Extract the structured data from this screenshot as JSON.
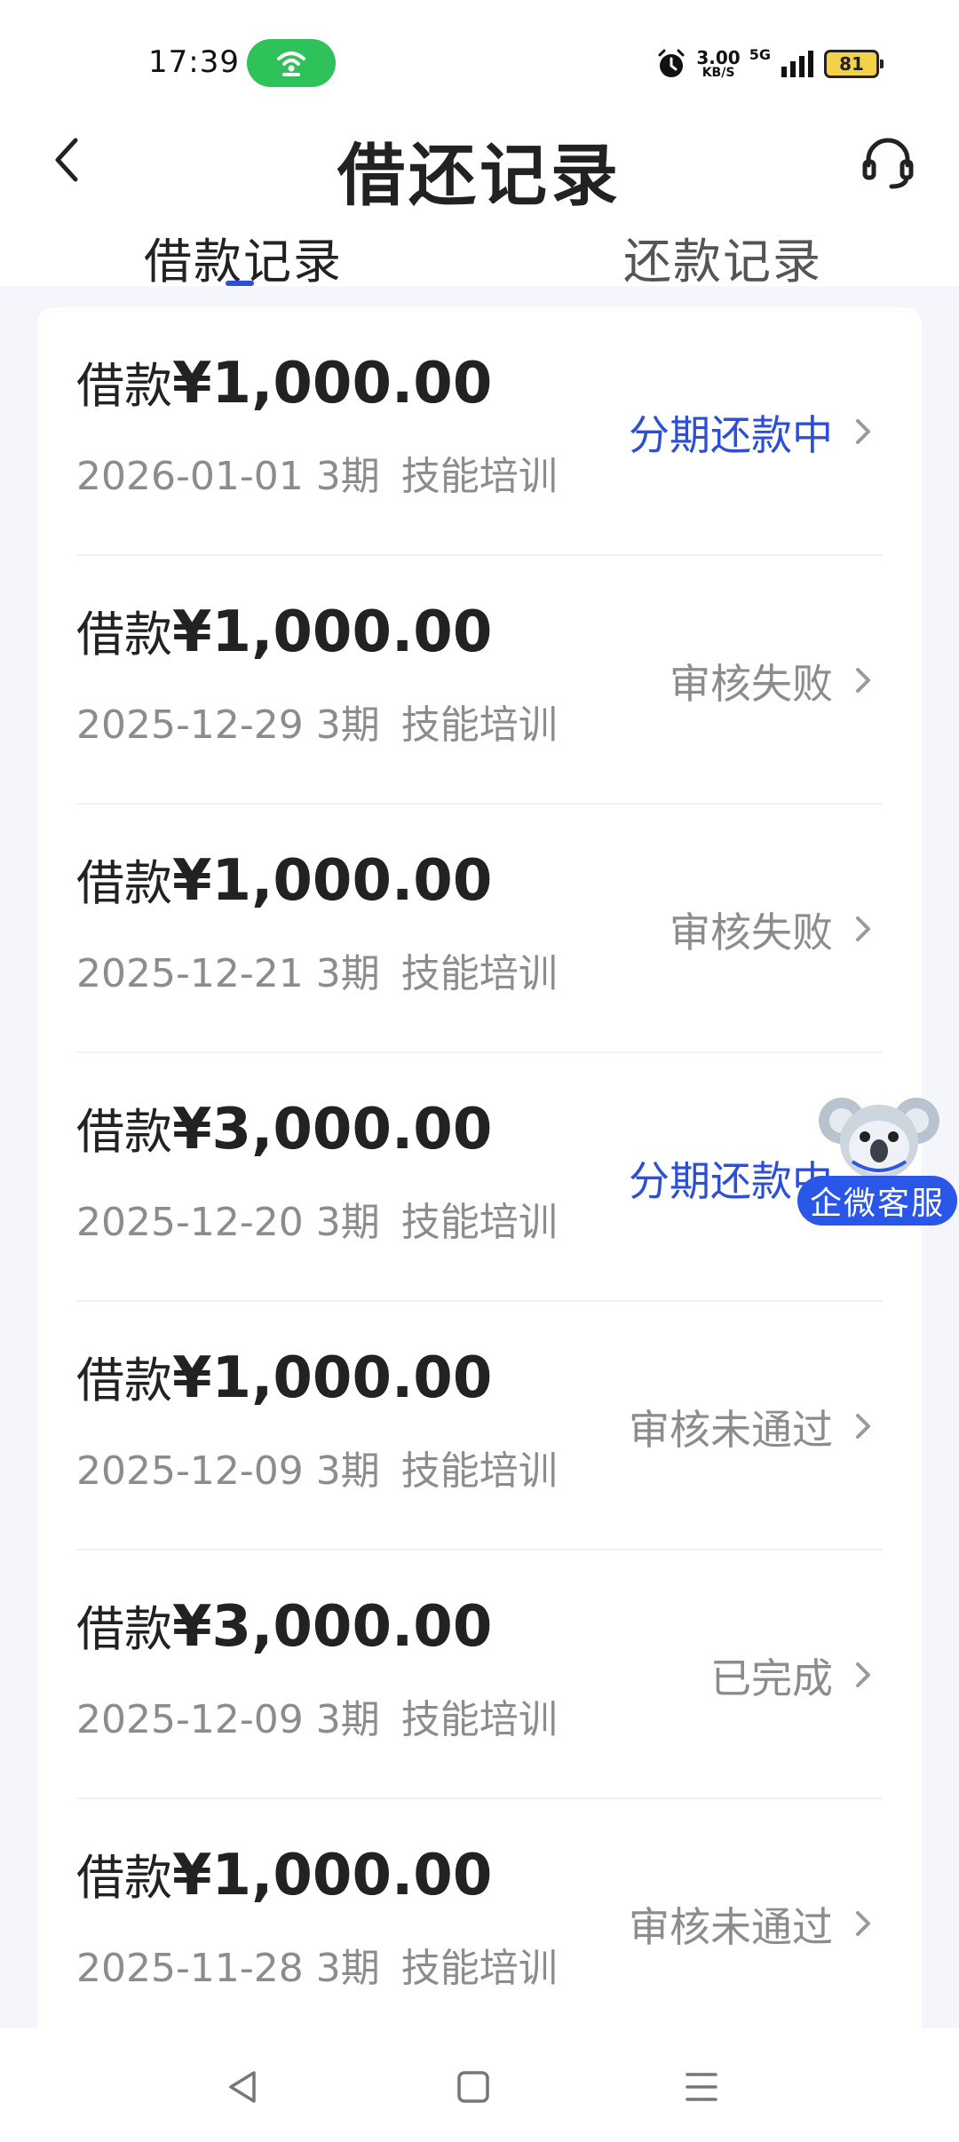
{
  "status_bar": {
    "time": "17:39",
    "network_speed_value": "3.00",
    "network_speed_unit": "KB/S",
    "network_type": "5G",
    "battery_level": "81",
    "hotspot_color": "#2fc25b"
  },
  "header": {
    "title": "借还记录",
    "back_icon": "chevron-left-icon",
    "service_icon": "headset-icon"
  },
  "tabs": [
    {
      "label": "借款记录",
      "active": true
    },
    {
      "label": "还款记录",
      "active": false
    }
  ],
  "records": [
    {
      "prefix": "借款",
      "amount": "¥1,000.00",
      "date": "2026-01-01",
      "term": "3期",
      "purpose": "技能培训",
      "status": "分期还款中",
      "status_color": "#2b4fd8"
    },
    {
      "prefix": "借款",
      "amount": "¥1,000.00",
      "date": "2025-12-29",
      "term": "3期",
      "purpose": "技能培训",
      "status": "审核失败",
      "status_color": "#8c8c8c"
    },
    {
      "prefix": "借款",
      "amount": "¥1,000.00",
      "date": "2025-12-21",
      "term": "3期",
      "purpose": "技能培训",
      "status": "审核失败",
      "status_color": "#8c8c8c"
    },
    {
      "prefix": "借款",
      "amount": "¥3,000.00",
      "date": "2025-12-20",
      "term": "3期",
      "purpose": "技能培训",
      "status": "分期还款中",
      "status_color": "#2b4fd8"
    },
    {
      "prefix": "借款",
      "amount": "¥1,000.00",
      "date": "2025-12-09",
      "term": "3期",
      "purpose": "技能培训",
      "status": "审核未通过",
      "status_color": "#8c8c8c"
    },
    {
      "prefix": "借款",
      "amount": "¥3,000.00",
      "date": "2025-12-09",
      "term": "3期",
      "purpose": "技能培训",
      "status": "已完成",
      "status_color": "#8c8c8c"
    },
    {
      "prefix": "借款",
      "amount": "¥1,000.00",
      "date": "2025-11-28",
      "term": "3期",
      "purpose": "技能培训",
      "status": "审核未通过",
      "status_color": "#8c8c8c"
    }
  ],
  "assistant": {
    "label": "企微客服",
    "icon": "koala-mascot-icon",
    "color": "#2b57e8"
  },
  "nav_bar": {
    "back_icon": "triangle-back-icon",
    "home_icon": "square-home-icon",
    "menu_icon": "menu-lines-icon"
  }
}
